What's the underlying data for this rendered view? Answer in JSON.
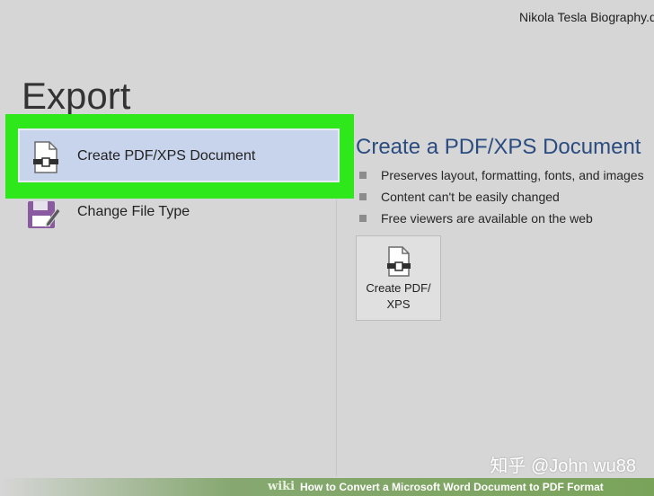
{
  "window": {
    "document_title": "Nikola Tesla Biography.docx"
  },
  "export": {
    "heading": "Export",
    "options": [
      {
        "label": "Create PDF/XPS Document",
        "icon": "pdf-document-icon",
        "selected": true
      },
      {
        "label": "Change File Type",
        "icon": "save-as-floppy-pen-icon",
        "selected": false
      }
    ]
  },
  "detail": {
    "title": "Create a PDF/XPS Document",
    "bullets": [
      "Preserves layout, formatting, fonts, and images",
      "Content can't be easily changed",
      "Free viewers are available on the web"
    ],
    "button": {
      "line1": "Create PDF/",
      "line2": "XPS",
      "icon": "pdf-document-icon"
    }
  },
  "overlay": {
    "watermark": "知乎 @John wu88",
    "wiki_brand": "wiki",
    "wiki_text": "How to Convert a Microsoft Word Document to PDF Format"
  },
  "colors": {
    "highlight": "#2ee81b",
    "selected_bg": "#c8d4ec",
    "title_blue": "#2b4c80",
    "background": "#d6d6d6"
  }
}
